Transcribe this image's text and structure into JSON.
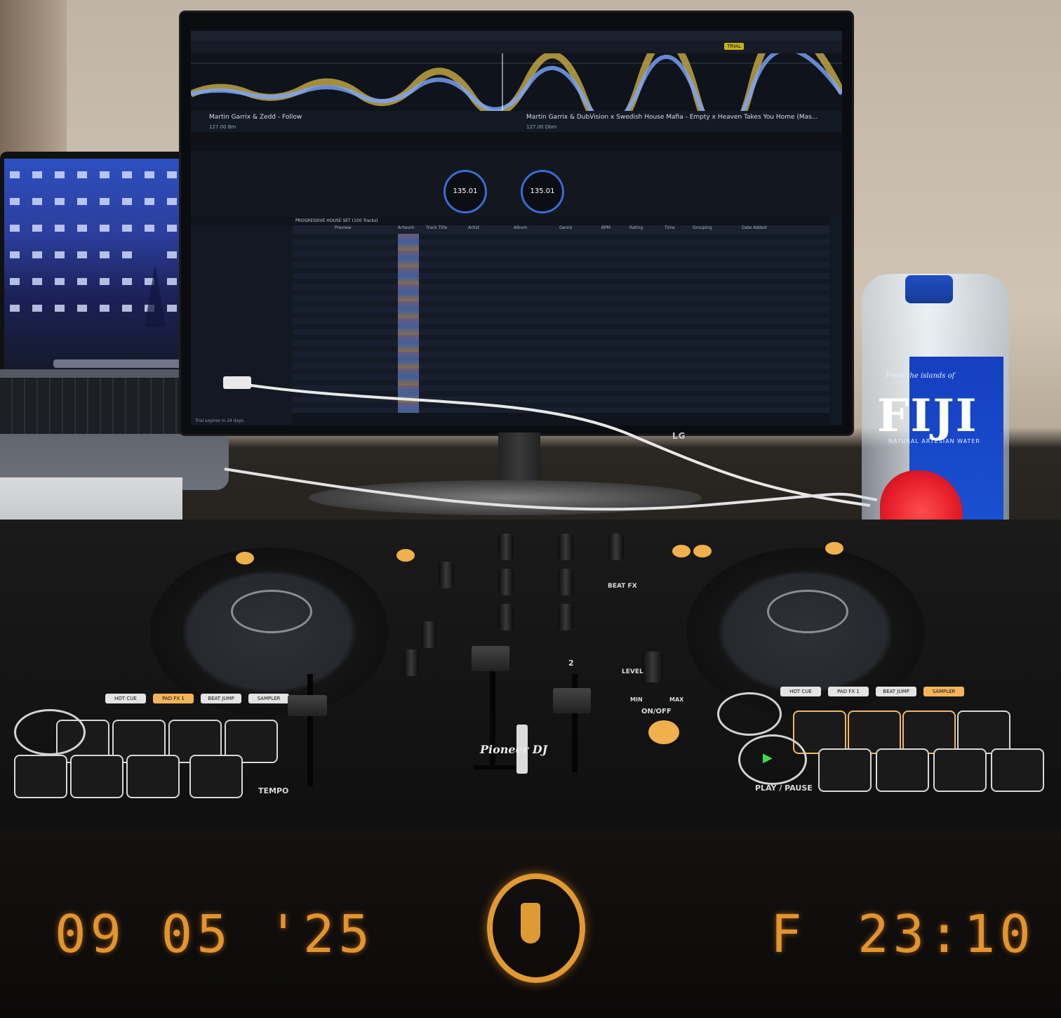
{
  "monitor": {
    "brand": "LG",
    "trial_badge": "TRIAL",
    "deck1": {
      "title": "Martin Garrix & Zedd - Follow",
      "bpm": "127.00 Bm",
      "jog_bpm": "135.01"
    },
    "deck2": {
      "title": "Martin Garrix & DubVision x Swedish House Mafia - Empty x Heaven Takes You Home (Mas...",
      "bpm": "127.00 Dbm",
      "jog_bpm": "135.01"
    },
    "playlist_title": "PROGRESSIVE HOUSE SET (100 Tracks)",
    "columns": [
      "Preview",
      "Artwork",
      "Track Title",
      "Artist",
      "Album",
      "Genre",
      "BPM",
      "Rating",
      "Time",
      "Grouping",
      "Date Added"
    ],
    "status": "Trial expires in 24 days."
  },
  "bottle": {
    "brand": "FIJI",
    "subtitle": "NATURAL ARTESIAN WATER",
    "script": "From the islands of"
  },
  "controller": {
    "brand": "Pioneer DJ",
    "labels": {
      "tempo": "TEMPO",
      "play_pause": "PLAY / PAUSE",
      "on_off": "ON/OFF",
      "level": "LEVEL",
      "min": "MIN",
      "max": "MAX",
      "beat_fx": "BEAT FX",
      "channel_2": "2"
    },
    "pad_modes_left": [
      "HOT CUE",
      "PAD FX 1",
      "BEAT JUMP",
      "SAMPLER"
    ],
    "pad_modes_right": [
      "HOT CUE",
      "PAD FX 1",
      "BEAT JUMP",
      "SAMPLER"
    ]
  },
  "date_stamp": {
    "date": "09 05 '25",
    "day": "F",
    "time": "23:10"
  },
  "colors": {
    "stamp": "#e2942e",
    "bottle_blue": "#1b58d9",
    "pad_lit": "#f1b66a",
    "hibiscus": "#e41c2a"
  }
}
